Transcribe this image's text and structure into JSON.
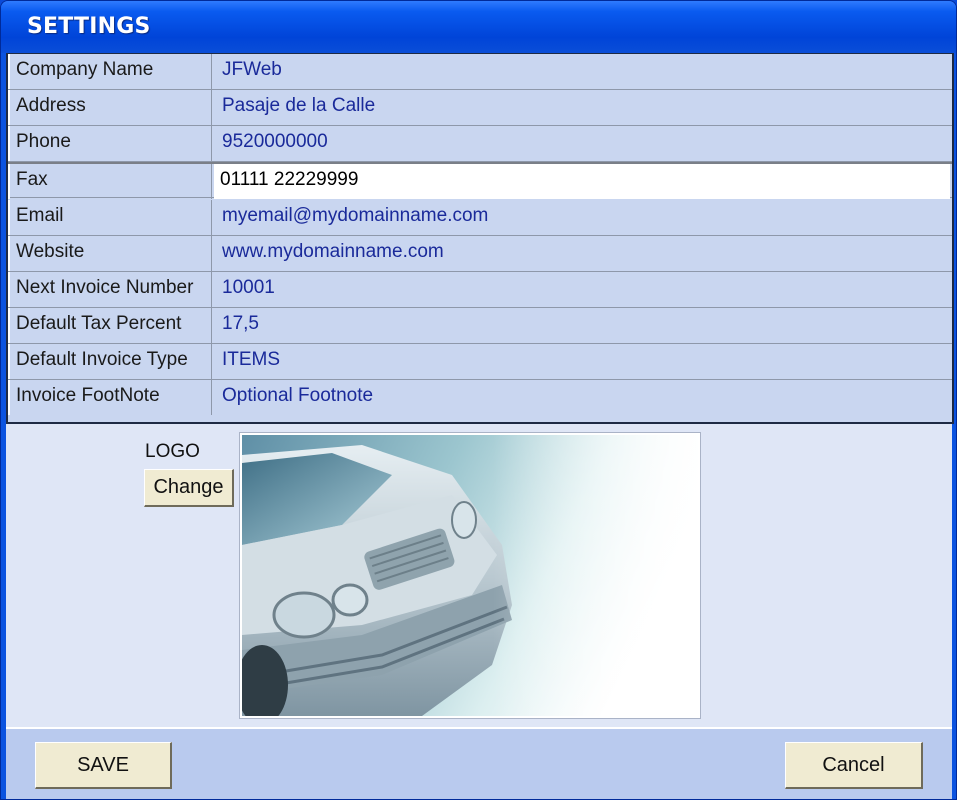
{
  "window": {
    "title": "SETTINGS"
  },
  "fields": [
    {
      "label": "Company Name",
      "value": "JFWeb"
    },
    {
      "label": "Address",
      "value": "Pasaje de la Calle"
    },
    {
      "label": "Phone",
      "value": "9520000000"
    },
    {
      "label": "Fax",
      "value": "01111 22229999"
    },
    {
      "label": "Email",
      "value": "myemail@mydomainname.com"
    },
    {
      "label": "Website",
      "value": "www.mydomainname.com"
    },
    {
      "label": "Next Invoice Number",
      "value": "10001"
    },
    {
      "label": "Default Tax Percent",
      "value": "17,5"
    },
    {
      "label": "Default Invoice Type",
      "value": "ITEMS"
    },
    {
      "label": "Invoice FootNote",
      "value": "Optional Footnote"
    }
  ],
  "active_field_index": 3,
  "logo": {
    "label": "LOGO",
    "change_label": "Change",
    "image": "car-logo-image"
  },
  "footer": {
    "save_label": "SAVE",
    "cancel_label": "Cancel"
  },
  "colors": {
    "titlebar": "#0044d8",
    "value_text": "#1a2a9a",
    "grid_bg": "#c9d6f0",
    "client_bg": "#dfe6f6",
    "footer_bg": "#b9caee"
  }
}
